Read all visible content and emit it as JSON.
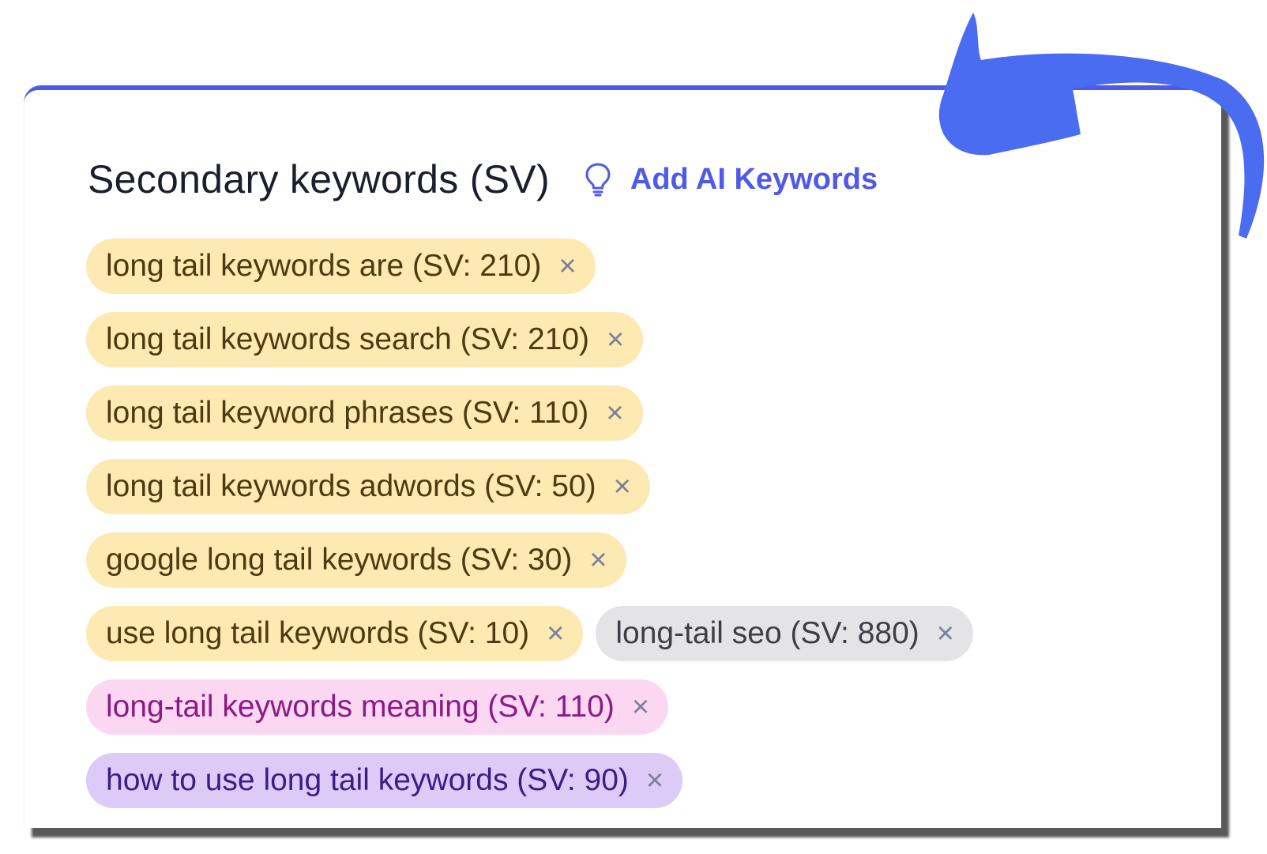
{
  "colors": {
    "accent": "#4f5ae8",
    "arrow": "#4a6cf0",
    "chip_yellow": "#fde9b2",
    "chip_gray": "#e4e4e6",
    "chip_pink": "#fcd7f2",
    "chip_purple": "#dccbf7"
  },
  "panel": {
    "title": "Secondary keywords (SV)",
    "ai_button": {
      "icon": "lightbulb-icon",
      "label": "Add AI Keywords"
    }
  },
  "chip_remove_glyph": "×",
  "keywords": [
    {
      "label": "long tail keywords are (SV: 210)",
      "color": "yellow"
    },
    {
      "label": "long tail keywords search (SV: 210)",
      "color": "yellow"
    },
    {
      "label": "long tail keyword phrases (SV: 110)",
      "color": "yellow"
    },
    {
      "label": "long tail keywords adwords (SV: 50)",
      "color": "yellow"
    },
    {
      "label": "google long tail keywords (SV: 30)",
      "color": "yellow"
    },
    {
      "label": "use long tail keywords (SV: 10)",
      "color": "yellow"
    },
    {
      "label": "long-tail seo (SV: 880)",
      "color": "gray"
    },
    {
      "label": "long-tail keywords meaning (SV: 110)",
      "color": "pink"
    },
    {
      "label": "how to use long tail keywords (SV: 90)",
      "color": "purple"
    }
  ],
  "annotation": {
    "icon": "curved-arrow-icon"
  }
}
